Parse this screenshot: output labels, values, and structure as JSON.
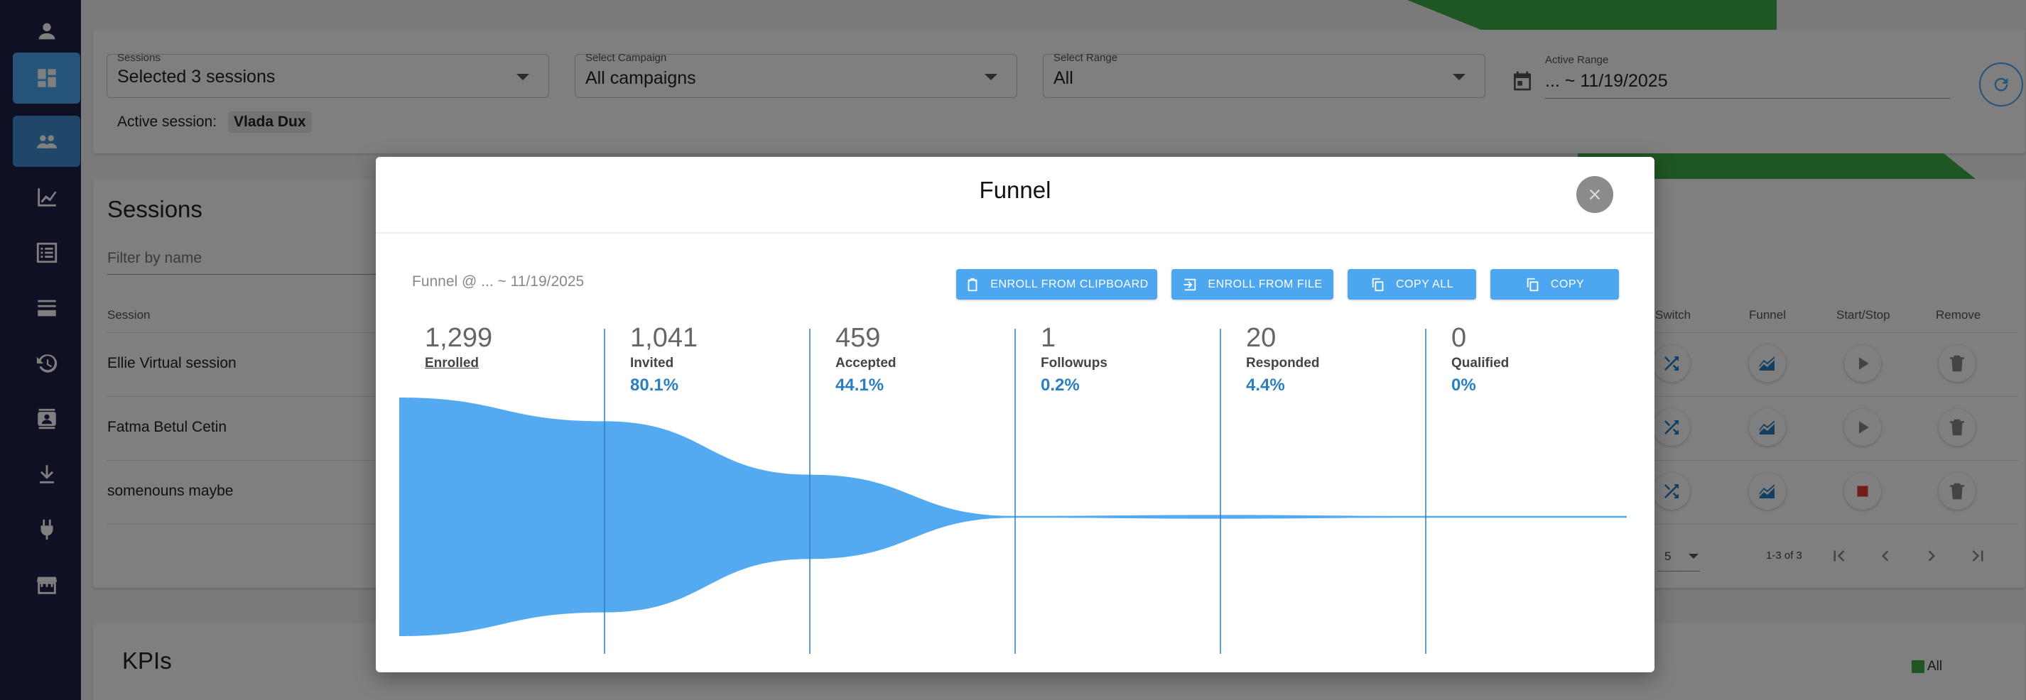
{
  "sidebar": {
    "items": [
      {
        "icon": "person-icon"
      },
      {
        "icon": "dashboard-icon",
        "active": true
      },
      {
        "icon": "people-icon",
        "active": true
      },
      {
        "icon": "chart-line-icon"
      },
      {
        "icon": "list-icon"
      },
      {
        "icon": "stack-icon"
      },
      {
        "icon": "history-icon"
      },
      {
        "icon": "contact-card-icon"
      },
      {
        "icon": "download-icon"
      },
      {
        "icon": "plug-icon"
      },
      {
        "icon": "storefront-icon"
      }
    ]
  },
  "filters": {
    "sessions": {
      "label": "Sessions",
      "value": "Selected 3 sessions"
    },
    "campaign": {
      "label": "Select Campaign",
      "value": "All campaigns"
    },
    "range": {
      "label": "Select Range",
      "value": "All"
    },
    "active_range": {
      "label": "Active Range",
      "value": "... ~ 11/19/2025"
    },
    "active_session_label": "Active session:",
    "active_session_value": "Vlada Dux"
  },
  "sessions_card": {
    "title": "Sessions",
    "filter_placeholder": "Filter by name",
    "columns": {
      "session": "Session",
      "switch": "Switch",
      "funnel": "Funnel",
      "start_stop": "Start/Stop",
      "remove": "Remove"
    },
    "rows": [
      {
        "name": "Ellie Virtual session",
        "state": "stopped"
      },
      {
        "name": "Fatma Betul Cetin",
        "state": "stopped"
      },
      {
        "name": "somenouns maybe",
        "state": "running"
      }
    ],
    "pagination": {
      "per_page": "5",
      "range": "1-3 of 3"
    }
  },
  "kpis": {
    "title": "KPIs",
    "legend": "All"
  },
  "modal": {
    "title": "Funnel",
    "subtitle": "Funnel @ ... ~ 11/19/2025",
    "buttons": {
      "enroll_clipboard": "ENROLL FROM CLIPBOARD",
      "enroll_file": "ENROLL FROM FILE",
      "copy_all": "COPY ALL",
      "copy": "COPY"
    },
    "stages": [
      {
        "count": "1,299",
        "name": "Enrolled",
        "pct": ""
      },
      {
        "count": "1,041",
        "name": "Invited",
        "pct": "80.1%"
      },
      {
        "count": "459",
        "name": "Accepted",
        "pct": "44.1%"
      },
      {
        "count": "1",
        "name": "Followups",
        "pct": "0.2%"
      },
      {
        "count": "20",
        "name": "Responded",
        "pct": "4.4%"
      },
      {
        "count": "0",
        "name": "Qualified",
        "pct": "0%"
      }
    ]
  },
  "chart_data": {
    "type": "area",
    "categories": [
      "Enrolled",
      "Invited",
      "Accepted",
      "Followups",
      "Responded",
      "Qualified"
    ],
    "values": [
      1299,
      1041,
      459,
      1,
      20,
      0
    ],
    "title": "Funnel",
    "color": "#53aaf1"
  },
  "colors": {
    "accent": "#4da6f0",
    "sidebar": "#1e2148",
    "green": "#3fae49",
    "percent": "#2b7fc0"
  }
}
